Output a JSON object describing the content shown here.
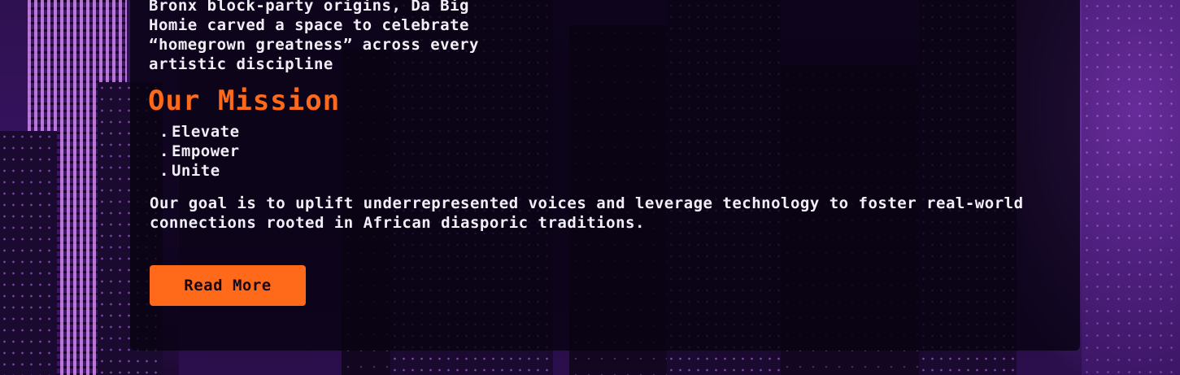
{
  "intro": {
    "lines": [
      "Bronx block-party origins, Da Big",
      "Homie carved a space to celebrate",
      "“homegrown greatness” across every",
      "artistic discipline"
    ]
  },
  "mission": {
    "title": "Our Mission",
    "pillars": [
      {
        "bullet": ".",
        "label": "Elevate"
      },
      {
        "bullet": ".",
        "label": "Empower"
      },
      {
        "bullet": ".",
        "label": "Unite"
      }
    ],
    "goal": "Our goal is to uplift underrepresented voices and leverage technology to foster real-world connections rooted in African diasporic traditions.",
    "cta_label": "Read More"
  },
  "colors": {
    "accent": "#ff6a1a",
    "text": "#f2eef7",
    "card_bg": "#080212",
    "background": "#1e0b36"
  }
}
